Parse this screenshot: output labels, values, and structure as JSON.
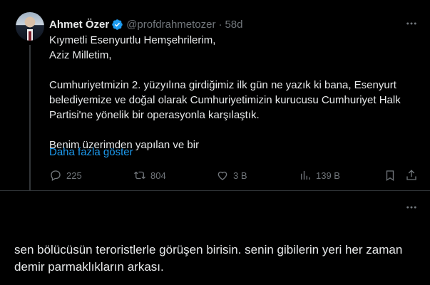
{
  "tweet": {
    "author_name": "Ahmet Özer",
    "handle": "@profdrahmetozer",
    "separator": "·",
    "time": "58d",
    "lines": [
      "Kıymetli Esenyurtlu Hemşehrilerim,",
      "Aziz Milletim,",
      "",
      "Cumhuriyetmizin 2. yüzyılına girdiğimiz ilk gün ne yazık ki bana, Esenyurt",
      "belediyemize ve doğal olarak Cumhuriyetimizin kurucusu Cumhuriyet Halk",
      "Partisi'ne yönelik bir operasyonla karşılaştık.",
      "",
      "Benim üzerimden yapılan ve bir"
    ],
    "show_more": "Daha fazla göster",
    "actions": {
      "replies": "225",
      "reposts": "804",
      "likes": "3 B",
      "views": "139 B"
    }
  },
  "reply": {
    "text_line1": "sen bölücüsün teroristlerle görüşen birisin. senin gibilerin yeri her zaman",
    "text_line2": "demir parmaklıkların arkası."
  },
  "colors": {
    "background": "#000000",
    "text": "#e7e9ea",
    "muted": "#71767b",
    "accent": "#1d9bf0",
    "divider": "#2f3336"
  },
  "icons": [
    "verified-badge-icon",
    "more-icon",
    "reply-icon",
    "repost-icon",
    "like-icon",
    "views-icon",
    "bookmark-icon",
    "share-icon"
  ]
}
